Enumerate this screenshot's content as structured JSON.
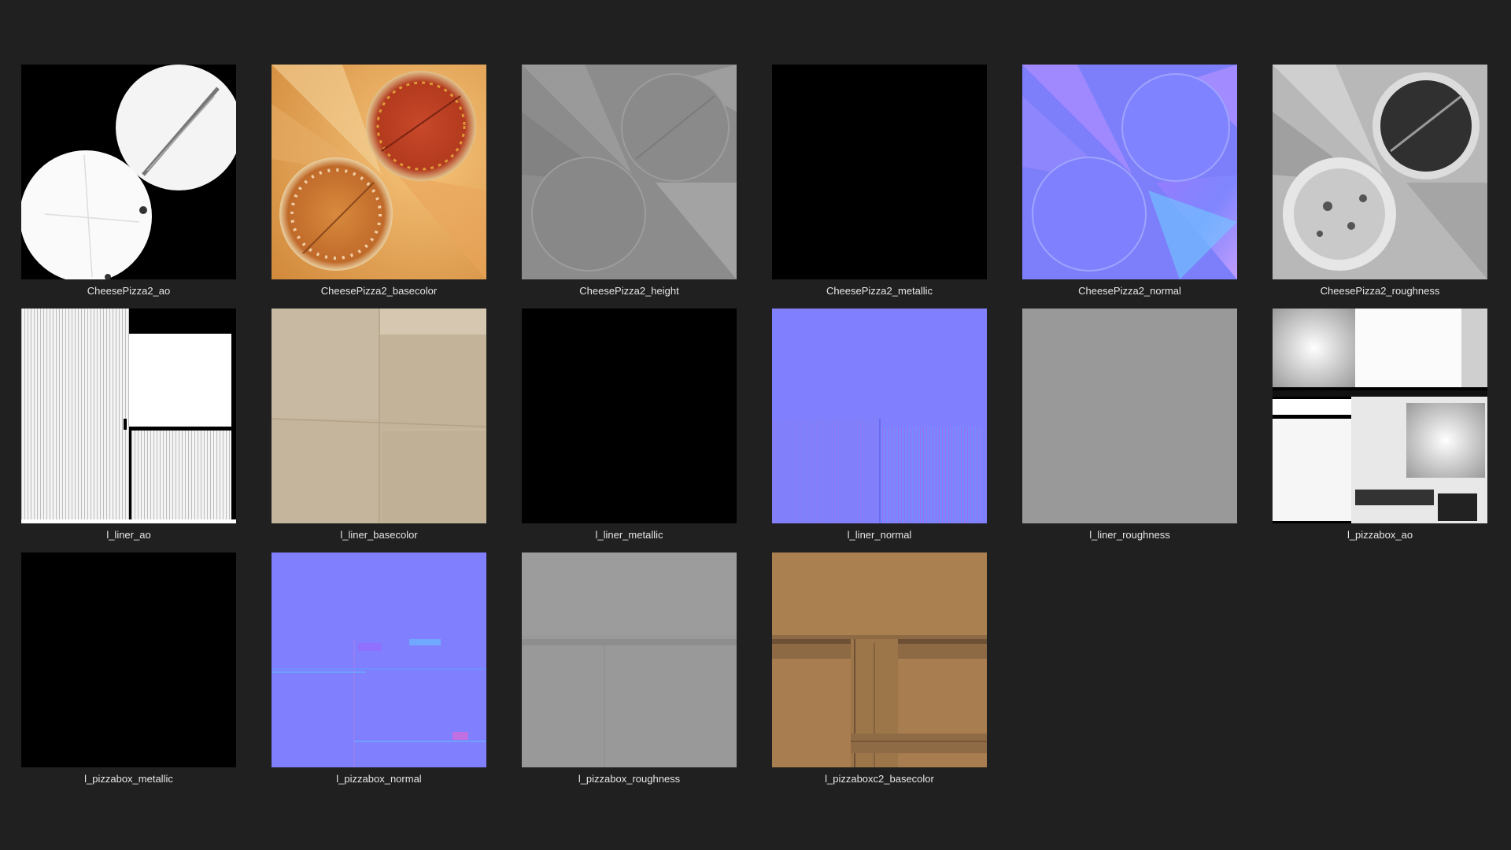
{
  "files": [
    {
      "name": "CheesePizza2_ao",
      "icon": "ao-map-thumbnail"
    },
    {
      "name": "CheesePizza2_basecolor",
      "icon": "basecolor-map-thumbnail"
    },
    {
      "name": "CheesePizza2_height",
      "icon": "height-map-thumbnail"
    },
    {
      "name": "CheesePizza2_metallic",
      "icon": "metallic-map-thumbnail"
    },
    {
      "name": "CheesePizza2_normal",
      "icon": "normal-map-thumbnail"
    },
    {
      "name": "CheesePizza2_roughness",
      "icon": "roughness-map-thumbnail"
    },
    {
      "name": "l_liner_ao",
      "icon": "ao-map-thumbnail"
    },
    {
      "name": "l_liner_basecolor",
      "icon": "basecolor-map-thumbnail"
    },
    {
      "name": "l_liner_metallic",
      "icon": "metallic-map-thumbnail"
    },
    {
      "name": "l_liner_normal",
      "icon": "normal-map-thumbnail"
    },
    {
      "name": "l_liner_roughness",
      "icon": "roughness-map-thumbnail"
    },
    {
      "name": "l_pizzabox_ao",
      "icon": "ao-map-thumbnail"
    },
    {
      "name": "l_pizzabox_metallic",
      "icon": "metallic-map-thumbnail"
    },
    {
      "name": "l_pizzabox_normal",
      "icon": "normal-map-thumbnail"
    },
    {
      "name": "l_pizzabox_roughness",
      "icon": "roughness-map-thumbnail"
    },
    {
      "name": "l_pizzaboxc2_basecolor",
      "icon": "basecolor-map-thumbnail"
    }
  ],
  "colors": {
    "background": "#202020",
    "label": "#e6e6e6",
    "normal_blue": "#8080ff",
    "liner_beige": "#c8b9a0",
    "cardboard": "#a67c4e",
    "roughness_gray": "#9a9a9a"
  }
}
